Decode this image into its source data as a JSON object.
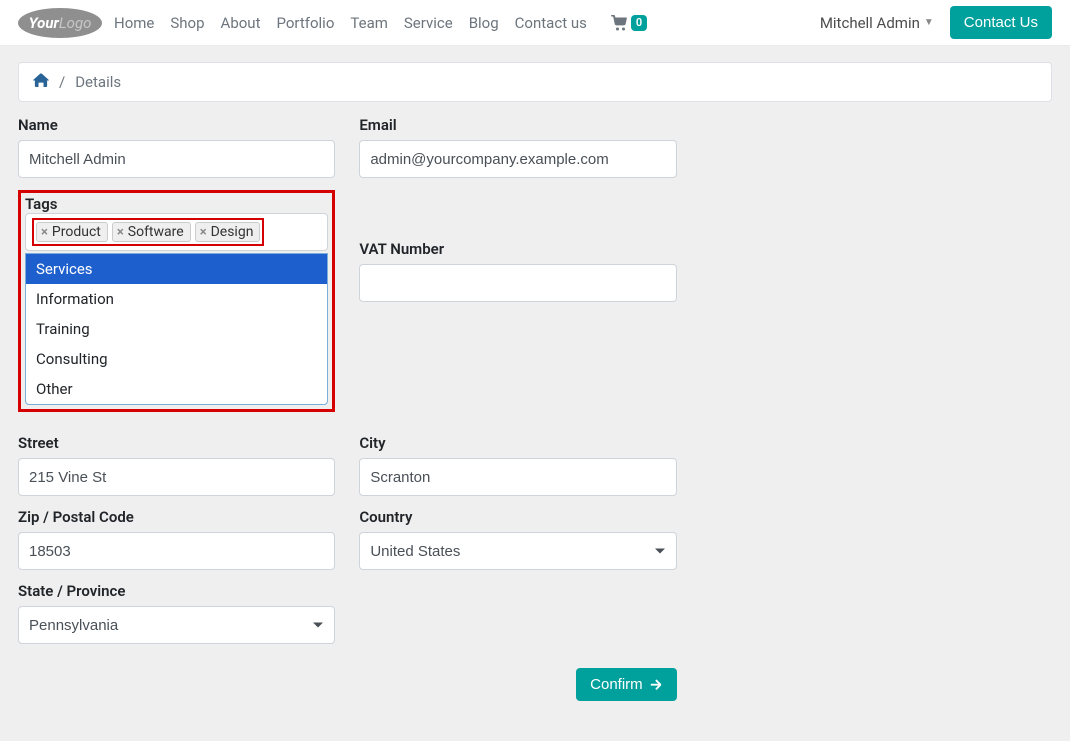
{
  "nav": {
    "items": [
      "Home",
      "Shop",
      "About",
      "Portfolio",
      "Team",
      "Service",
      "Blog",
      "Contact us"
    ],
    "cart_count": "0",
    "user": "Mitchell Admin",
    "contact_btn": "Contact Us"
  },
  "breadcrumb": {
    "current": "Details"
  },
  "fields": {
    "name_label": "Name",
    "name_value": "Mitchell Admin",
    "email_label": "Email",
    "email_value": "admin@yourcompany.example.com",
    "tags_label": "Tags",
    "tags_selected": [
      "Product",
      "Software",
      "Design"
    ],
    "tags_options": [
      "Services",
      "Information",
      "Training",
      "Consulting",
      "Other"
    ],
    "vat_label": "VAT Number",
    "vat_value": "",
    "street_label": "Street",
    "street_value": "215 Vine St",
    "city_label": "City",
    "city_value": "Scranton",
    "zip_label": "Zip / Postal Code",
    "zip_value": "18503",
    "country_label": "Country",
    "country_value": "United States",
    "state_label": "State / Province",
    "state_value": "Pennsylvania"
  },
  "actions": {
    "confirm": "Confirm"
  }
}
